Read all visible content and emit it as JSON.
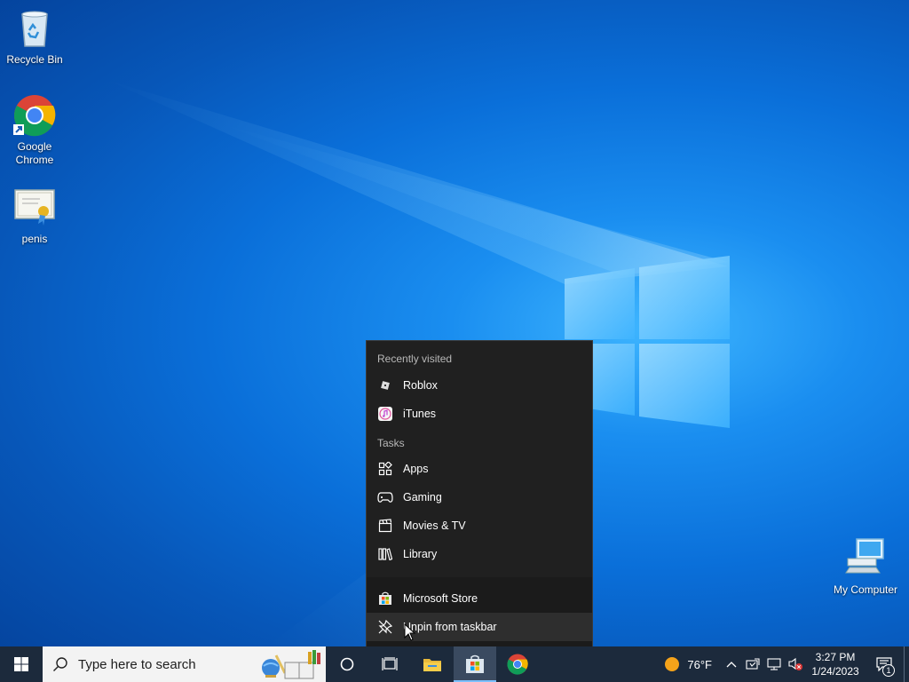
{
  "desktop": {
    "icons": [
      {
        "label": "Recycle Bin",
        "icon": "recycle-bin-icon"
      },
      {
        "label": "Google Chrome",
        "icon": "chrome-icon"
      },
      {
        "label": "penis",
        "icon": "certificate-icon"
      },
      {
        "label": "My Computer",
        "icon": "computer-icon"
      }
    ]
  },
  "jumplist": {
    "recent_header": "Recently visited",
    "recent": [
      {
        "label": "Roblox",
        "icon": "roblox-icon"
      },
      {
        "label": "iTunes",
        "icon": "itunes-icon"
      }
    ],
    "tasks_header": "Tasks",
    "tasks": [
      {
        "label": "Apps",
        "icon": "apps-icon"
      },
      {
        "label": "Gaming",
        "icon": "gamepad-icon"
      },
      {
        "label": "Movies & TV",
        "icon": "clapperboard-icon"
      },
      {
        "label": "Library",
        "icon": "library-icon"
      }
    ],
    "app_name": "Microsoft Store",
    "unpin_label": "Unpin from taskbar"
  },
  "taskbar": {
    "search_placeholder": "Type here to search",
    "weather": "76°F",
    "time": "3:27 PM",
    "date": "1/24/2023",
    "notification_count": "1"
  },
  "colors": {
    "taskbar": "#1c2a3c",
    "jumplist_bg": "#202020",
    "accent": "#7cc0ff"
  }
}
